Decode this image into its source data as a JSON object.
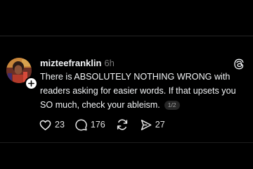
{
  "post": {
    "username": "mizteefranklin",
    "time": "6h",
    "text": "There is ABSOLUTELY NOTHING WRONG with readers asking for easier words. If that upsets you SO much, check your ableism.",
    "page_indicator": "1/2"
  },
  "actions": {
    "likes": "23",
    "replies": "176",
    "shares": "27"
  },
  "icons": {
    "app_logo": "threads-logo-icon",
    "like": "heart-icon",
    "reply": "comment-bubble-icon",
    "repost": "repost-icon",
    "share": "send-icon",
    "follow": "plus-icon"
  },
  "colors": {
    "background": "#000000",
    "text": "#f3f5f7",
    "muted": "#777777"
  }
}
